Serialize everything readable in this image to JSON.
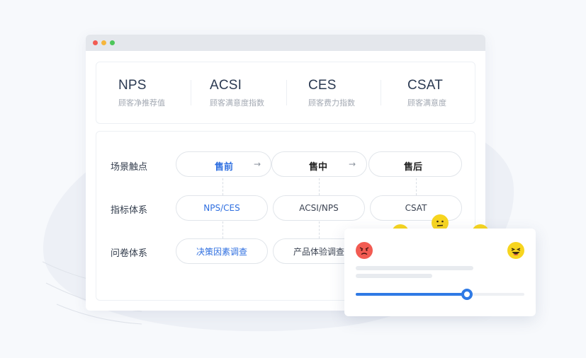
{
  "window": {
    "controls": [
      "close",
      "minimize",
      "maximize"
    ]
  },
  "metrics": [
    {
      "name": "NPS",
      "desc": "顾客净推荐值"
    },
    {
      "name": "ACSI",
      "desc": "顾客满意度指数"
    },
    {
      "name": "CES",
      "desc": "顾客费力指数"
    },
    {
      "name": "CSAT",
      "desc": "顾客满意度"
    }
  ],
  "flow": {
    "rows": [
      {
        "label": "场景触点"
      },
      {
        "label": "指标体系"
      },
      {
        "label": "问卷体系"
      }
    ],
    "stages": [
      "售前",
      "售中",
      "售后"
    ],
    "indicators": [
      "NPS/CES",
      "ACSI/NPS",
      "CSAT"
    ],
    "surveys": [
      "决策因素调查",
      "产品体验调查"
    ]
  },
  "rating": {
    "faces": [
      "angry-face-icon",
      "frown-face-icon",
      "neutral-face-icon",
      "smile-face-icon",
      "laugh-face-icon"
    ],
    "slider_value": 0.66,
    "colors": {
      "accent": "#2f7ae5",
      "angry": "#f25b52",
      "yellow": "#f7d51f"
    }
  }
}
